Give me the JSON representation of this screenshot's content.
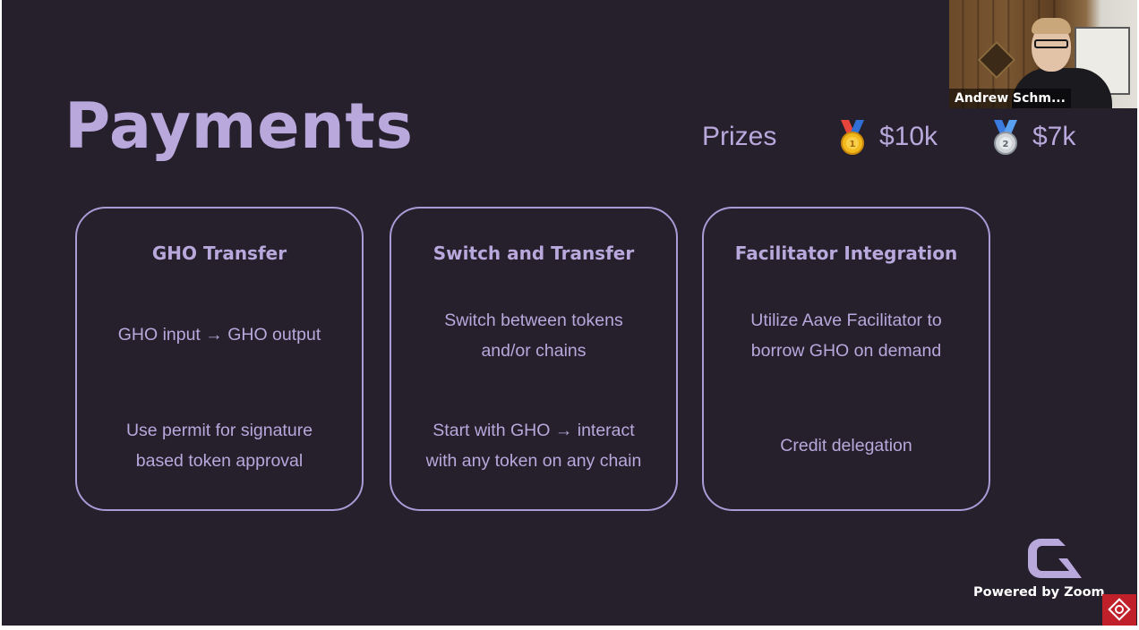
{
  "slide": {
    "title": "Payments",
    "prizes": {
      "label": "Prizes",
      "first": {
        "medal_icon": "gold-medal-icon",
        "amount": "$10k"
      },
      "second": {
        "medal_icon": "silver-medal-icon",
        "amount": "$7k"
      }
    },
    "cards": [
      {
        "title": "GHO Transfer",
        "text_1": "GHO input → GHO output",
        "text_2_line_1": "Use permit for signature",
        "text_2_line_2": "based token approval"
      },
      {
        "title": "Switch and Transfer",
        "text_1_line_1": "Switch between tokens",
        "text_1_line_2": "and/or chains",
        "text_2_line_1": "Start with GHO → interact",
        "text_2_line_2": "with any token on any chain"
      },
      {
        "title": "Facilitator Integration",
        "text_1_line_1": "Utilize Aave Facilitator to",
        "text_1_line_2": "borrow GHO on demand",
        "text_2": "Credit delegation"
      }
    ],
    "logo_icon": "gho-logo-icon"
  },
  "video": {
    "participant_name": "Andrew Schm..."
  },
  "footer": {
    "powered_by": "Powered by Zoom",
    "corner_icon": "zoom-app-icon"
  },
  "colors": {
    "background": "#25202c",
    "accent": "#b8a8dc",
    "card_border": "#a99bd6"
  }
}
